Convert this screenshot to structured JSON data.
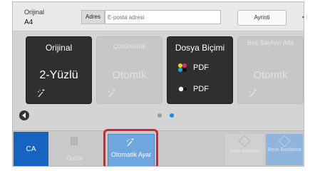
{
  "header": {
    "original_label": "Orijinal",
    "original_value": "A4",
    "address_button": "Adres",
    "email_placeholder": "E-posta adresi",
    "details_button": "Ayrinti"
  },
  "tiles": [
    {
      "title": "Orijinal",
      "value": "2-Yüzlü",
      "enabled": true,
      "icon": "settings-wand-icon"
    },
    {
      "title": "Çözünürlük",
      "value": "Otomtk",
      "enabled": false,
      "icon": "settings-wand-icon"
    },
    {
      "title": "Dosya Biçimi",
      "formats": [
        "PDF",
        "PDF"
      ],
      "enabled": true,
      "icon": "color-dots-icon"
    },
    {
      "title": "Boş Sayfayı Atla",
      "value": "Otomtk",
      "enabled": false,
      "icon": "settings-wand-icon"
    }
  ],
  "pager": {
    "pages": 2,
    "current": 2
  },
  "footer": {
    "ca": "CA",
    "preview": "Önizle",
    "auto_set": "Otomatik Ayar",
    "bw_start": "Siyah Başlatma",
    "color_start": "Renk Başlatma"
  },
  "colors": {
    "accent_blue": "#1565c0",
    "selected_button": "#6fa6dd",
    "highlight_border": "#e0202b",
    "tile_dark": "#2f2f2f"
  }
}
